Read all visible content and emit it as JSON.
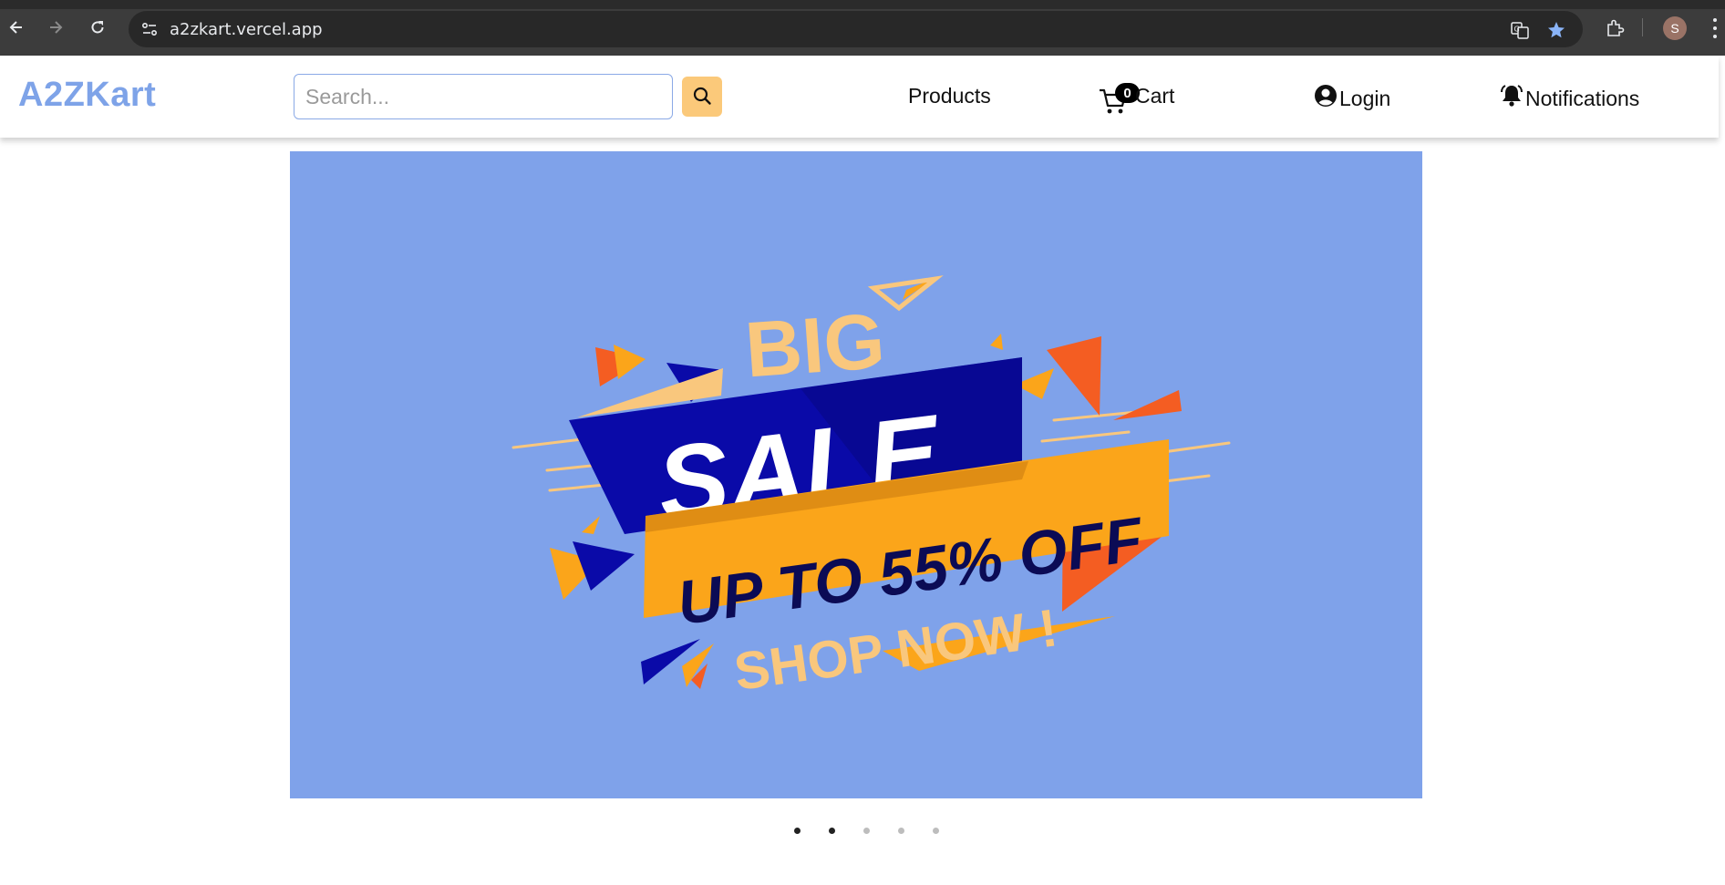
{
  "browser": {
    "url": "a2zkart.vercel.app",
    "profile_initial": "S",
    "icons": [
      "back-arrow-icon",
      "forward-arrow-icon",
      "reload-icon",
      "site-info-icon",
      "translate-icon",
      "bookmark-star-icon",
      "extensions-icon",
      "more-menu-icon"
    ]
  },
  "header": {
    "brand": "A2ZKart",
    "search_placeholder": "Search...",
    "nav": {
      "products": "Products",
      "cart": "Cart",
      "cart_count": "0",
      "login": "Login",
      "notifications": "Notifications"
    }
  },
  "banner": {
    "line_big": "BIG",
    "line_sale": "SALE",
    "line_offer": "UP TO 55% OFF",
    "line_cta": "SHOP NOW !",
    "colors": {
      "background": "#7fa2ea",
      "navy": "#0a0aa8",
      "orange": "#fba51a",
      "peach": "#f9c77d",
      "red_orange": "#f45d22"
    }
  },
  "carousel": {
    "slide_count": 5,
    "active_slide": 1
  },
  "colors": {
    "brand": "#7ea3e8",
    "search_button": "#fbc97a"
  }
}
